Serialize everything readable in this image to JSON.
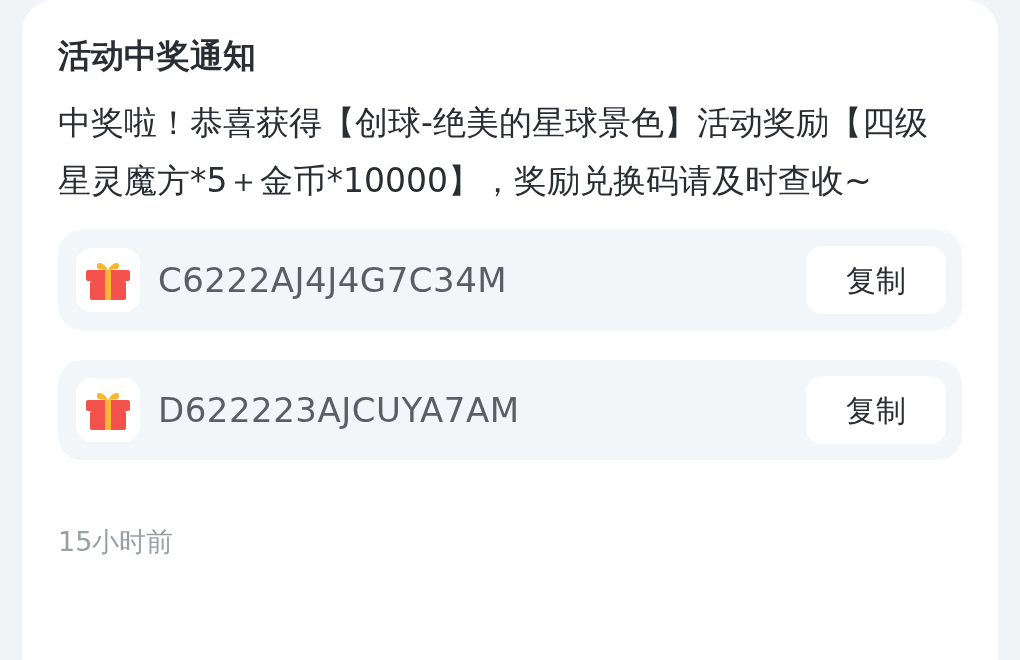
{
  "title": "活动中奖通知",
  "message": "中奖啦！恭喜获得【创球-绝美的星球景色】活动奖励【四级星灵魔方*5＋金币*10000】，奖励兑换码请及时查收~",
  "codes": [
    {
      "code": "C6222AJ4J4G7C34M",
      "button": "复制"
    },
    {
      "code": "D622223AJCUYA7AM",
      "button": "复制"
    }
  ],
  "time": "15小时前"
}
